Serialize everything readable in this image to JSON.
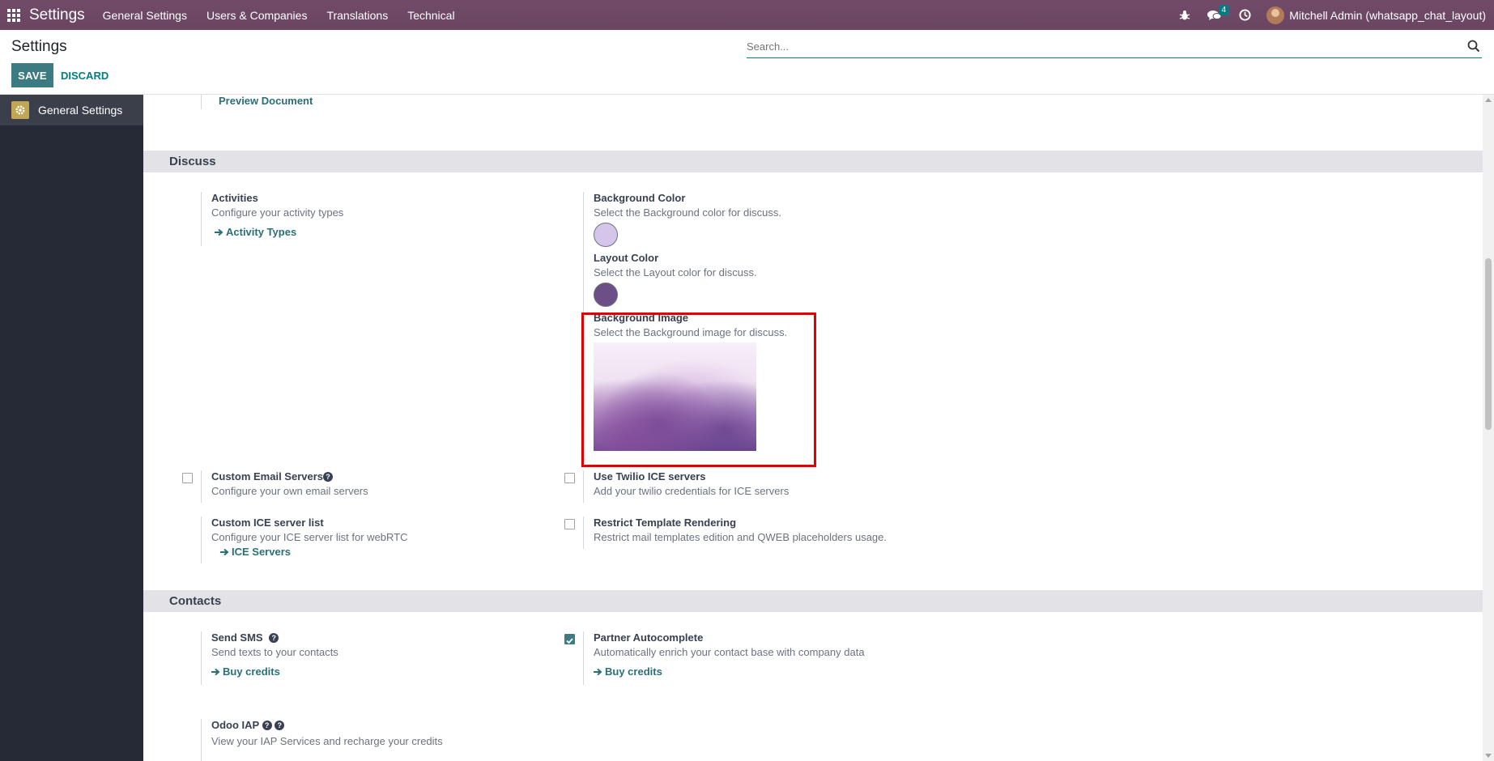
{
  "navbar": {
    "app_title": "Settings",
    "menu": [
      "General Settings",
      "Users & Companies",
      "Translations",
      "Technical"
    ],
    "messages_count": "4",
    "user_name": "Mitchell Admin (whatsapp_chat_layout)"
  },
  "control_panel": {
    "title": "Settings",
    "save_label": "SAVE",
    "discard_label": "DISCARD",
    "search_placeholder": "Search..."
  },
  "sidebar": {
    "items": [
      {
        "label": "General Settings"
      }
    ]
  },
  "content": {
    "top_link": "Preview Document",
    "discuss": {
      "heading": "Discuss",
      "activities": {
        "title": "Activities",
        "desc": "Configure your activity types",
        "link": "Activity Types"
      },
      "background_color": {
        "title": "Background Color",
        "desc": "Select the Background color for discuss.",
        "value": "#d6c5ea"
      },
      "layout_color": {
        "title": "Layout Color",
        "desc": "Select the Layout color for discuss.",
        "value": "#6c4f86"
      },
      "background_image": {
        "title": "Background Image",
        "desc": "Select the Background image for discuss."
      },
      "custom_email_servers": {
        "title": "Custom Email Servers",
        "desc": "Configure your own email servers",
        "checked": false
      },
      "use_twilio": {
        "title": "Use Twilio ICE servers",
        "desc": "Add your twilio credentials for ICE servers",
        "checked": false
      },
      "custom_ice": {
        "title": "Custom ICE server list",
        "desc": "Configure your ICE server list for webRTC",
        "link": "ICE Servers"
      },
      "restrict_template": {
        "title": "Restrict Template Rendering",
        "desc": "Restrict mail templates edition and QWEB placeholders usage.",
        "checked": false
      }
    },
    "contacts": {
      "heading": "Contacts",
      "send_sms": {
        "title": "Send SMS",
        "desc": "Send texts to your contacts",
        "link": "Buy credits"
      },
      "partner_autocomplete": {
        "title": "Partner Autocomplete",
        "desc": "Automatically enrich your contact base with company data",
        "link": "Buy credits",
        "checked": true
      },
      "odoo_iap": {
        "title": "Odoo IAP",
        "desc": "View your IAP Services and recharge your credits"
      }
    }
  }
}
